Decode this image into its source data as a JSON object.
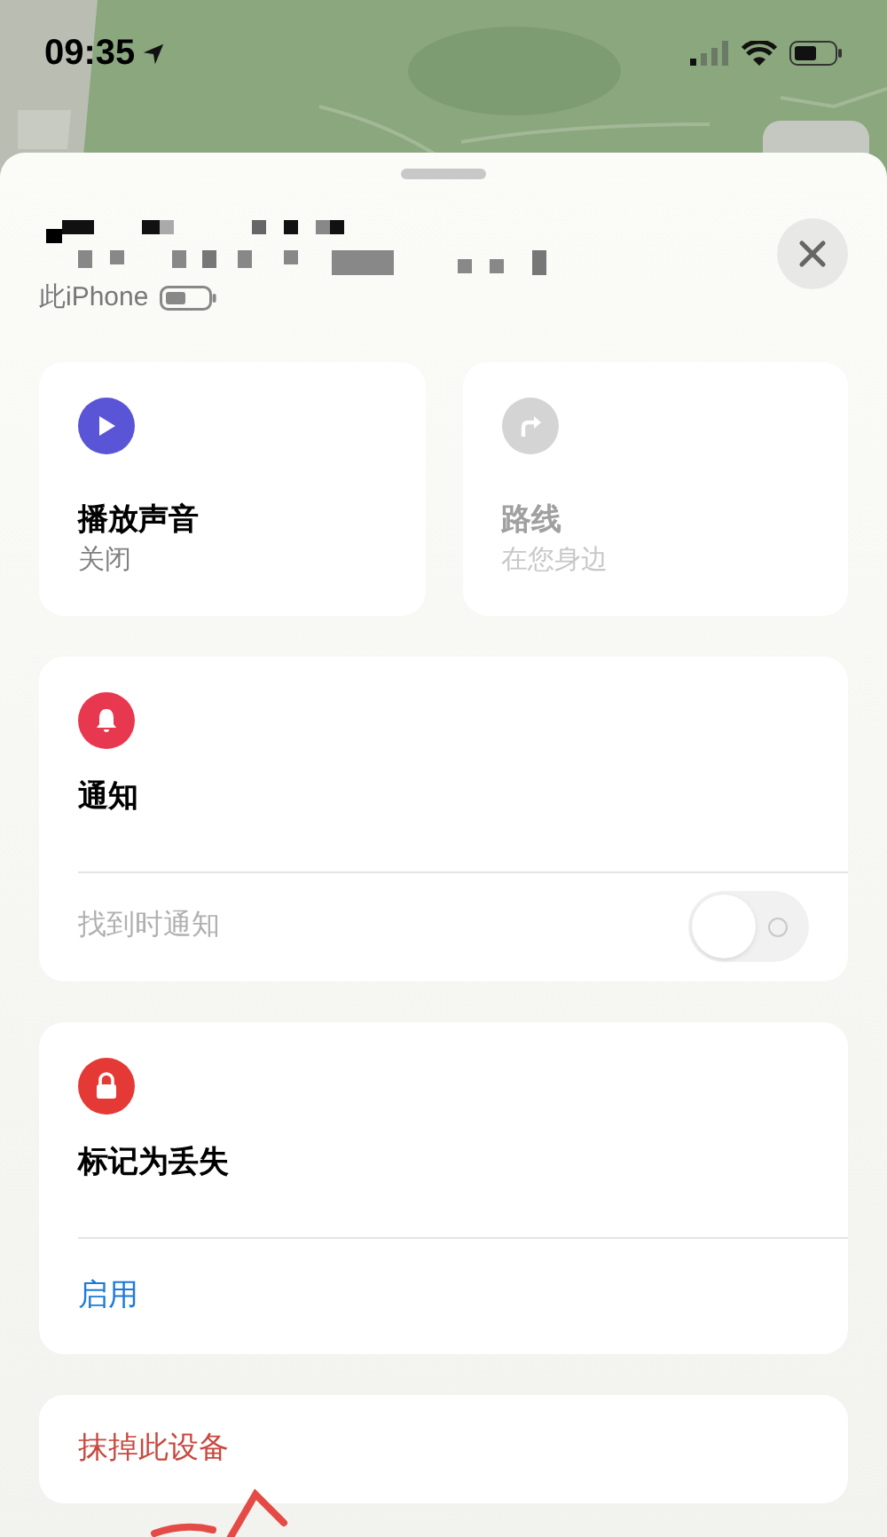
{
  "status_bar": {
    "time": "09:35"
  },
  "device": {
    "subtitle": "此iPhone"
  },
  "actions": [
    {
      "kind": "sound",
      "title": "播放声音",
      "subtitle": "关闭",
      "disabled": false
    },
    {
      "kind": "directions",
      "title": "路线",
      "subtitle": "在您身边",
      "disabled": true
    }
  ],
  "notifications": {
    "title": "通知",
    "option": {
      "label": "找到时通知",
      "on": false,
      "disabled": true
    }
  },
  "lost_mode": {
    "title": "标记为丢失",
    "action": "启用"
  },
  "erase": {
    "label": "抹掉此设备"
  }
}
